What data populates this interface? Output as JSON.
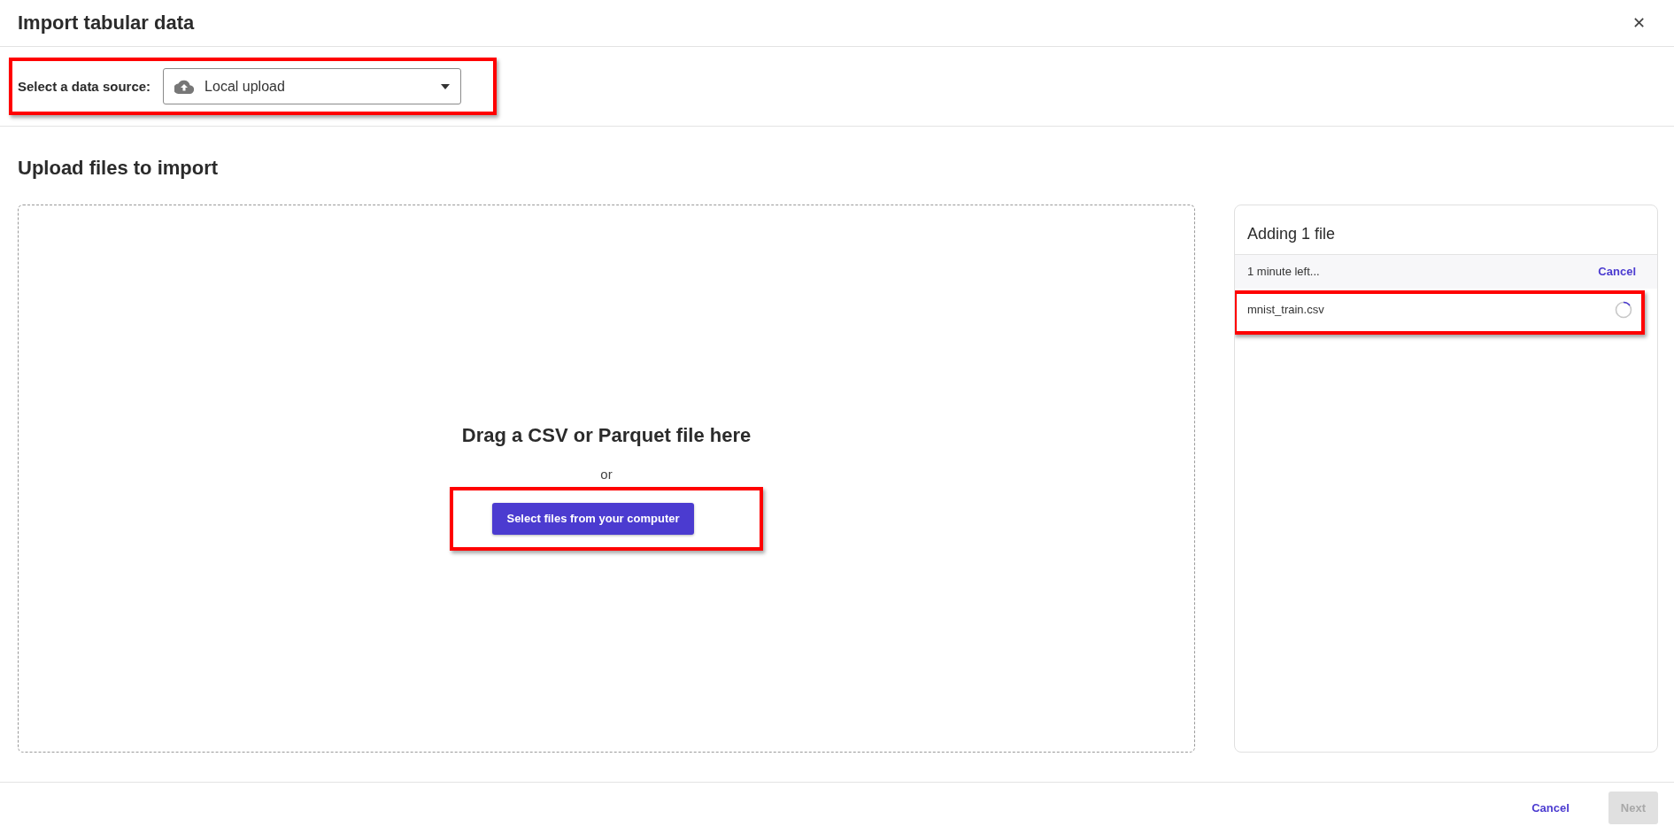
{
  "dialog": {
    "title": "Import tabular data",
    "close": "✕"
  },
  "source": {
    "label": "Select a data source:",
    "value": "Local upload",
    "highlighted": true
  },
  "upload": {
    "title": "Upload files to import",
    "dropzone": {
      "heading": "Drag a CSV or Parquet file here",
      "separator": "or",
      "button": {
        "label": "Select files from your computer",
        "highlighted": true
      }
    },
    "progress": {
      "title": "Adding 1 file",
      "status": "1 minute left...",
      "cancel": "Cancel",
      "files": [
        {
          "name": "mnist_train.csv",
          "loading": true,
          "highlighted": true
        }
      ]
    }
  },
  "footer": {
    "cancel": {
      "label": "Cancel",
      "disabled": false
    },
    "next": {
      "label": "Next",
      "disabled": true
    }
  }
}
